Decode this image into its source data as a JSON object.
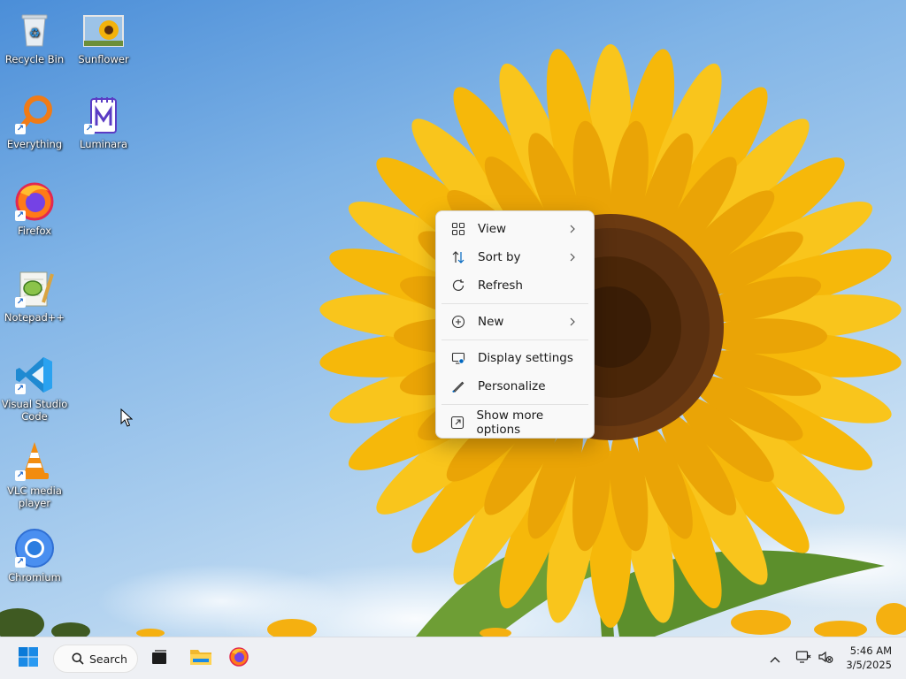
{
  "desktop": {
    "icons": [
      {
        "label": "Recycle Bin",
        "icon": "recycle-bin-icon"
      },
      {
        "label": "Sunflower",
        "icon": "image-file-icon"
      },
      {
        "label": "Everything",
        "icon": "everything-search-icon"
      },
      {
        "label": "Luminara",
        "icon": "luminara-icon"
      },
      {
        "label": "Firefox",
        "icon": "firefox-icon"
      },
      {
        "label": "Notepad++",
        "icon": "notepad-plus-plus-icon"
      },
      {
        "label": "Visual Studio Code",
        "icon": "vscode-icon"
      },
      {
        "label": "VLC media player",
        "icon": "vlc-icon"
      },
      {
        "label": "Chromium",
        "icon": "chromium-icon"
      }
    ]
  },
  "context_menu": {
    "items": [
      {
        "label": "View",
        "icon": "view-grid-icon",
        "submenu": true
      },
      {
        "label": "Sort by",
        "icon": "sort-icon",
        "submenu": true
      },
      {
        "label": "Refresh",
        "icon": "refresh-icon",
        "submenu": false
      },
      {
        "label": "New",
        "icon": "plus-circle-icon",
        "submenu": true
      },
      {
        "label": "Display settings",
        "icon": "display-settings-icon",
        "submenu": false
      },
      {
        "label": "Personalize",
        "icon": "pen-icon",
        "submenu": false
      },
      {
        "label": "Show more options",
        "icon": "open-external-icon",
        "submenu": false
      }
    ]
  },
  "taskbar": {
    "search_label": "Search",
    "pinned": [
      "start-icon",
      "task-view-icon",
      "file-explorer-icon",
      "firefox-icon"
    ],
    "tray": [
      "chevron-up-icon",
      "network-icon",
      "volume-muted-icon"
    ],
    "time": "5:46 AM",
    "date": "3/5/2025"
  },
  "colors": {
    "accent": "#0078d4",
    "menu_bg": "#f9f9f9",
    "taskbar_bg": "#eef0f4",
    "petal": "#f6b80a",
    "flower_center": "#5a3010"
  }
}
